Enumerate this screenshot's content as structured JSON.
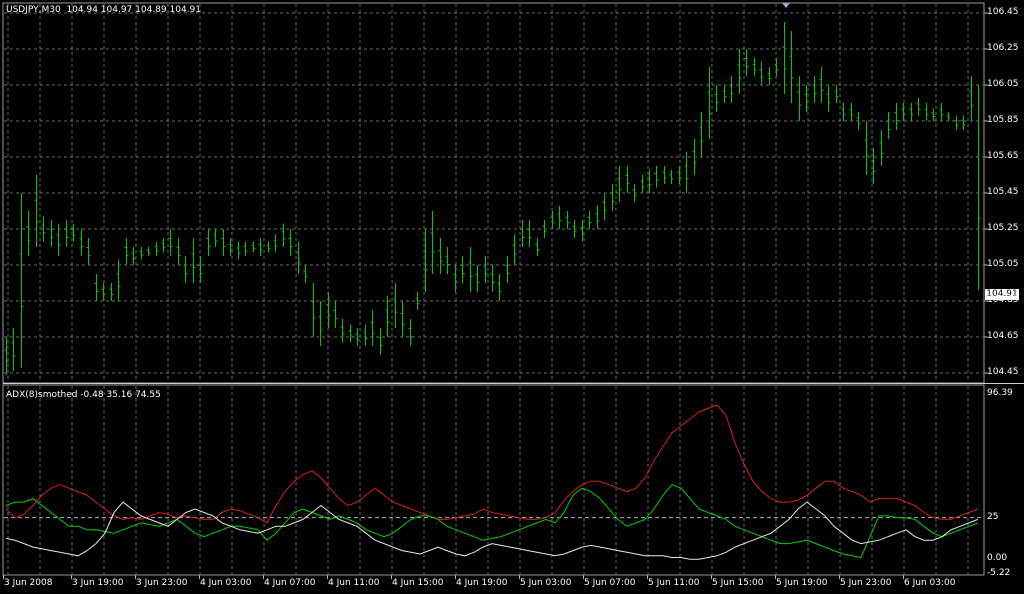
{
  "window": {
    "symbol_label": "USDJPY,M30",
    "ohlc_label": "104.94 104.97 104.89 104.91",
    "current_price": "104.91"
  },
  "price_axis": [
    "106.45",
    "106.25",
    "106.05",
    "105.85",
    "105.65",
    "105.45",
    "105.25",
    "105.05",
    "104.85",
    "104.65",
    "104.45"
  ],
  "time_axis": [
    "3 Jun 2008",
    "3 Jun 19:00",
    "3 Jun 23:00",
    "4 Jun 03:00",
    "4 Jun 07:00",
    "4 Jun 11:00",
    "4 Jun 15:00",
    "4 Jun 19:00",
    "5 Jun 03:00",
    "5 Jun 07:00",
    "5 Jun 11:00",
    "5 Jun 15:00",
    "5 Jun 19:00",
    "5 Jun 23:00",
    "6 Jun 03:00"
  ],
  "indicator": {
    "title": "ADX(8)smothed -0.48 35.16 74.55",
    "axis_labels": [
      "96.39",
      "25",
      "0.00",
      "-5.22"
    ],
    "level": 25
  },
  "colors": {
    "background": "#000000",
    "grid": "#6e6e6e",
    "bar": "#00c800",
    "adx_red": "#d81e1e",
    "adx_green": "#00d000",
    "adx_white": "#e8e8e8"
  },
  "chart_data": [
    {
      "type": "ohlc",
      "series_label": "USDJPY,M30",
      "ylim": [
        104.4,
        106.5
      ],
      "y_ticks": [
        104.45,
        104.65,
        104.85,
        105.05,
        105.25,
        105.45,
        105.65,
        105.85,
        106.05,
        106.25,
        106.45
      ],
      "bars": [
        [
          104.65,
          104.44
        ],
        [
          104.7,
          104.46
        ],
        [
          105.45,
          104.48
        ],
        [
          105.35,
          105.1
        ],
        [
          105.55,
          105.15
        ],
        [
          105.32,
          105.18
        ],
        [
          105.3,
          105.15
        ],
        [
          105.28,
          105.1
        ],
        [
          105.3,
          105.15
        ],
        [
          105.28,
          105.18
        ],
        [
          105.25,
          105.1
        ],
        [
          105.2,
          105.05
        ],
        [
          105.0,
          104.85
        ],
        [
          104.95,
          104.85
        ],
        [
          104.95,
          104.85
        ],
        [
          105.08,
          104.85
        ],
        [
          105.2,
          105.05
        ],
        [
          105.15,
          105.05
        ],
        [
          105.15,
          105.08
        ],
        [
          105.15,
          105.1
        ],
        [
          105.18,
          105.1
        ],
        [
          105.2,
          105.12
        ],
        [
          105.25,
          105.1
        ],
        [
          105.2,
          105.05
        ],
        [
          105.1,
          104.95
        ],
        [
          105.2,
          104.95
        ],
        [
          105.1,
          104.95
        ],
        [
          105.25,
          105.1
        ],
        [
          105.25,
          105.15
        ],
        [
          105.25,
          105.1
        ],
        [
          105.2,
          105.1
        ],
        [
          105.18,
          105.08
        ],
        [
          105.18,
          105.1
        ],
        [
          105.18,
          105.12
        ],
        [
          105.2,
          105.1
        ],
        [
          105.18,
          105.12
        ],
        [
          105.22,
          105.12
        ],
        [
          105.28,
          105.15
        ],
        [
          105.25,
          105.1
        ],
        [
          105.18,
          105.0
        ],
        [
          105.05,
          104.95
        ],
        [
          104.95,
          104.65
        ],
        [
          104.85,
          104.6
        ],
        [
          104.9,
          104.7
        ],
        [
          104.85,
          104.7
        ],
        [
          104.75,
          104.62
        ],
        [
          104.72,
          104.62
        ],
        [
          104.7,
          104.6
        ],
        [
          104.72,
          104.6
        ],
        [
          104.8,
          104.6
        ],
        [
          104.7,
          104.55
        ],
        [
          104.88,
          104.65
        ],
        [
          104.95,
          104.7
        ],
        [
          104.85,
          104.65
        ],
        [
          104.75,
          104.6
        ],
        [
          104.9,
          104.8
        ],
        [
          105.25,
          104.9
        ],
        [
          105.35,
          105.0
        ],
        [
          105.2,
          105.0
        ],
        [
          105.15,
          105.0
        ],
        [
          105.05,
          104.9
        ],
        [
          105.1,
          104.95
        ],
        [
          105.15,
          104.9
        ],
        [
          105.05,
          104.9
        ],
        [
          105.1,
          104.95
        ],
        [
          105.05,
          104.9
        ],
        [
          105.0,
          104.85
        ],
        [
          105.1,
          104.95
        ],
        [
          105.22,
          105.05
        ],
        [
          105.3,
          105.15
        ],
        [
          105.3,
          105.15
        ],
        [
          105.2,
          105.1
        ],
        [
          105.3,
          105.2
        ],
        [
          105.35,
          105.25
        ],
        [
          105.38,
          105.25
        ],
        [
          105.35,
          105.25
        ],
        [
          105.3,
          105.2
        ],
        [
          105.3,
          105.18
        ],
        [
          105.35,
          105.25
        ],
        [
          105.38,
          105.25
        ],
        [
          105.45,
          105.3
        ],
        [
          105.5,
          105.35
        ],
        [
          105.6,
          105.4
        ],
        [
          105.6,
          105.45
        ],
        [
          105.5,
          105.4
        ],
        [
          105.55,
          105.45
        ],
        [
          105.58,
          105.45
        ],
        [
          105.6,
          105.48
        ],
        [
          105.6,
          105.5
        ],
        [
          105.58,
          105.5
        ],
        [
          105.6,
          105.5
        ],
        [
          105.68,
          105.45
        ],
        [
          105.75,
          105.55
        ],
        [
          105.9,
          105.65
        ],
        [
          106.15,
          105.75
        ],
        [
          106.05,
          105.9
        ],
        [
          106.05,
          105.95
        ],
        [
          106.1,
          105.95
        ],
        [
          106.25,
          106.0
        ],
        [
          106.25,
          106.1
        ],
        [
          106.2,
          106.1
        ],
        [
          106.18,
          106.05
        ],
        [
          106.15,
          106.05
        ],
        [
          106.2,
          106.1
        ],
        [
          106.4,
          106.0
        ],
        [
          106.35,
          105.95
        ],
        [
          106.1,
          105.85
        ],
        [
          106.05,
          105.9
        ],
        [
          106.1,
          105.95
        ],
        [
          106.15,
          105.95
        ],
        [
          106.05,
          105.9
        ],
        [
          106.05,
          105.95
        ],
        [
          105.95,
          105.85
        ],
        [
          105.95,
          105.85
        ],
        [
          105.9,
          105.8
        ],
        [
          105.85,
          105.55
        ],
        [
          105.7,
          105.5
        ],
        [
          105.8,
          105.6
        ],
        [
          105.9,
          105.75
        ],
        [
          105.95,
          105.8
        ],
        [
          105.95,
          105.85
        ],
        [
          105.95,
          105.85
        ],
        [
          105.98,
          105.88
        ],
        [
          105.95,
          105.85
        ],
        [
          105.92,
          105.85
        ],
        [
          105.95,
          105.85
        ],
        [
          105.9,
          105.85
        ],
        [
          105.88,
          105.8
        ],
        [
          105.88,
          105.8
        ],
        [
          106.1,
          105.85
        ],
        [
          106.05,
          104.91
        ]
      ]
    },
    {
      "type": "line",
      "title": "ADX(8)smothed -0.48 35.16 74.55",
      "ylim": [
        -5.22,
        96.39
      ],
      "level": 25,
      "series": [
        {
          "color": "red",
          "values": [
            30,
            25,
            27,
            32,
            38,
            42,
            44,
            42,
            40,
            38,
            34,
            30,
            26,
            24,
            25,
            24,
            26,
            28,
            27,
            25,
            26,
            25,
            24,
            24,
            28,
            30,
            29,
            27,
            25,
            22,
            32,
            40,
            46,
            50,
            52,
            48,
            42,
            36,
            32,
            34,
            38,
            42,
            38,
            34,
            32,
            30,
            28,
            26,
            24,
            24,
            25,
            26,
            27,
            30,
            28,
            27,
            26,
            25,
            24,
            24,
            25,
            28,
            35,
            40,
            44,
            46,
            46,
            44,
            42,
            40,
            42,
            48,
            58,
            66,
            74,
            78,
            82,
            86,
            88,
            90,
            84,
            68,
            56,
            46,
            40,
            36,
            34,
            34,
            35,
            38,
            42,
            46,
            46,
            42,
            40,
            38,
            34,
            36,
            36,
            36,
            34,
            32,
            28,
            25,
            24,
            24,
            26,
            28,
            30
          ]
        },
        {
          "color": "green",
          "values": [
            32,
            34,
            34,
            36,
            32,
            28,
            24,
            20,
            20,
            18,
            18,
            17,
            16,
            18,
            20,
            22,
            21,
            20,
            22,
            24,
            20,
            16,
            14,
            16,
            18,
            20,
            20,
            19,
            18,
            12,
            16,
            22,
            28,
            30,
            28,
            26,
            24,
            26,
            24,
            22,
            18,
            16,
            14,
            16,
            20,
            24,
            26,
            26,
            24,
            20,
            18,
            16,
            14,
            12,
            13,
            14,
            16,
            18,
            20,
            22,
            24,
            22,
            28,
            38,
            42,
            40,
            36,
            30,
            24,
            20,
            22,
            24,
            30,
            38,
            44,
            42,
            36,
            30,
            28,
            26,
            24,
            20,
            18,
            16,
            14,
            12,
            10,
            10,
            11,
            12,
            10,
            8,
            6,
            4,
            3,
            2,
            14,
            26,
            26,
            25,
            25,
            24,
            20,
            16,
            14,
            16,
            18,
            20,
            22
          ]
        },
        {
          "color": "white",
          "values": [
            13,
            12,
            10,
            8,
            7,
            6,
            5,
            4,
            3,
            6,
            10,
            16,
            28,
            34,
            30,
            26,
            24,
            22,
            20,
            24,
            28,
            30,
            28,
            26,
            22,
            20,
            18,
            17,
            16,
            18,
            20,
            20,
            22,
            24,
            28,
            32,
            28,
            24,
            22,
            20,
            16,
            12,
            10,
            8,
            6,
            5,
            4,
            6,
            8,
            6,
            4,
            3,
            5,
            8,
            10,
            9,
            8,
            7,
            6,
            5,
            4,
            3,
            4,
            6,
            8,
            9,
            8,
            7,
            6,
            5,
            4,
            3,
            3,
            3,
            2,
            2,
            1,
            1,
            2,
            3,
            5,
            8,
            10,
            12,
            14,
            16,
            20,
            24,
            30,
            34,
            30,
            26,
            20,
            16,
            12,
            10,
            11,
            12,
            14,
            16,
            18,
            14,
            12,
            12,
            14,
            18,
            20,
            22,
            24
          ]
        }
      ]
    }
  ]
}
